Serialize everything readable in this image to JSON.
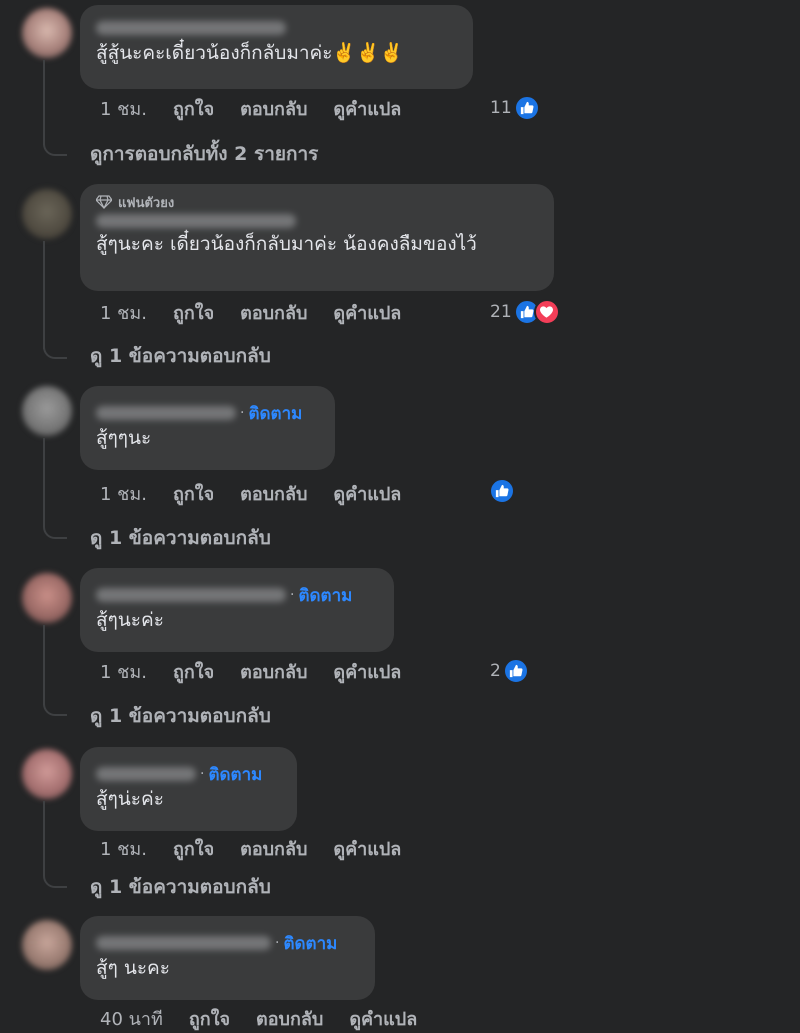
{
  "colors": {
    "background": "#242526",
    "bubble": "#3a3b3c",
    "text": "#e4e6eb",
    "muted": "#b0b3b8",
    "link": "#2d88ff",
    "like": "#1b74e4",
    "love": "#f33e58"
  },
  "labels": {
    "like": "ถูกใจ",
    "reply": "ตอบกลับ",
    "translate": "ดูคำแปล",
    "follow": "ติดตาม",
    "dot": "·"
  },
  "comments": [
    {
      "text": "สู้สู้นะคะเดี๋ยวน้องก็กลับมาค่ะ✌️✌️✌️",
      "time": "1 ชม.",
      "reaction_count": "11",
      "reactions": [
        "like-icon"
      ],
      "view_replies": "ดูการตอบกลับทั้ง 2 รายการ"
    },
    {
      "badge": "แฟนตัวยง",
      "badge_icon": "diamond-icon",
      "text": "สู้ๆนะคะ เดี๋ยวน้องก็กลับมาค่ะ น้องคงลืมของไว้",
      "time": "1 ชม.",
      "reaction_count": "21",
      "reactions": [
        "like-icon",
        "love-icon"
      ],
      "view_replies": "ดู 1 ข้อความตอบกลับ"
    },
    {
      "text": "สู้ๆๆนะ",
      "time": "1 ชม.",
      "reaction_count": "",
      "reactions": [
        "like-icon"
      ],
      "view_replies": "ดู 1 ข้อความตอบกลับ"
    },
    {
      "text": "สู้ๆนะค่ะ",
      "time": "1 ชม.",
      "reaction_count": "2",
      "reactions": [
        "like-icon"
      ],
      "view_replies": "ดู 1 ข้อความตอบกลับ"
    },
    {
      "text": "สู้ๆน่ะค่ะ",
      "time": "1 ชม.",
      "view_replies": "ดู 1 ข้อความตอบกลับ"
    },
    {
      "text": "สู้ๆ นะคะ",
      "time": "40 นาที"
    }
  ]
}
